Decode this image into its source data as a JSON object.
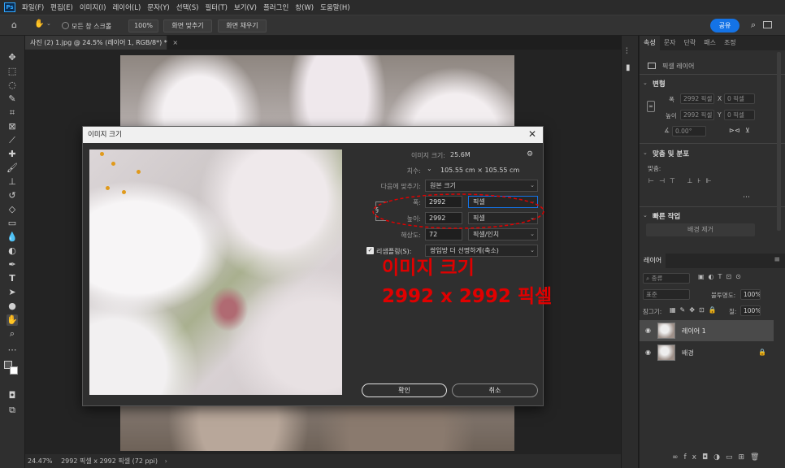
{
  "menubar": {
    "items": [
      "파일(F)",
      "편집(E)",
      "이미지(I)",
      "레이어(L)",
      "문자(Y)",
      "선택(S)",
      "필터(T)",
      "보기(V)",
      "플러그인",
      "창(W)",
      "도움말(H)"
    ]
  },
  "optionsbar": {
    "scroll_all": "모든 창 스크롤",
    "zoom_100": "100%",
    "fit_screen": "화면 맞추기",
    "fill_screen": "화면 채우기",
    "share": "공유"
  },
  "document": {
    "tab_title": "사진 (2) 1.jpg @ 24.5% (레이어 1, RGB/8*) *",
    "tab_close": "×"
  },
  "statusbar": {
    "zoom": "24.47%",
    "info": "2992 픽셀 x 2992 픽셀 (72 ppi)"
  },
  "properties": {
    "tabs": [
      "속성",
      "문자",
      "단락",
      "패스",
      "조정"
    ],
    "layer_type": "픽셀 레이어",
    "transform_title": "변형",
    "w_label": "폭",
    "w_value": "2992 픽셀",
    "x_label": "X",
    "x_value": "0 픽셀",
    "h_label": "높이",
    "h_value": "2992 픽셀",
    "y_label": "Y",
    "y_value": "0 픽셀",
    "angle_value": "0.00°",
    "align_title": "맞춤 및 분포",
    "align_label": "맞춤:",
    "quick_title": "빠른 작업",
    "remove_bg": "배경 제거"
  },
  "layers": {
    "tab": "레이어",
    "kind": "종류",
    "blend": "표준",
    "opacity_label": "불투명도:",
    "opacity_value": "100%",
    "lock_label": "잠그기:",
    "fill_label": "칠:",
    "fill_value": "100%",
    "items": [
      {
        "name": "레이어 1",
        "selected": true
      },
      {
        "name": "배경",
        "selected": false
      }
    ]
  },
  "dialog": {
    "title": "이미지 크기",
    "image_size_label": "이미지 크기:",
    "image_size_value": "25.6M",
    "dimensions_label": "치수:",
    "dimensions_value": "105.55 cm  ×  105.55 cm",
    "fit_to_label": "다음에 맞추기:",
    "fit_to_value": "원본 크기",
    "width_label": "폭:",
    "width_value": "2992",
    "width_unit": "픽셀",
    "height_label": "높이:",
    "height_value": "2992",
    "height_unit": "픽셀",
    "resolution_label": "해상도:",
    "resolution_value": "72",
    "resolution_unit": "픽셀/인치",
    "resample_label": "리샘플링(S):",
    "resample_value": "쌍입방 더 선명하게(축소)",
    "resample_checked": true,
    "ok": "확인",
    "cancel": "취소"
  },
  "annotation": {
    "line1": "이미지 크기",
    "line2": "2992 x 2992 픽셀",
    "color": "#e00000"
  }
}
